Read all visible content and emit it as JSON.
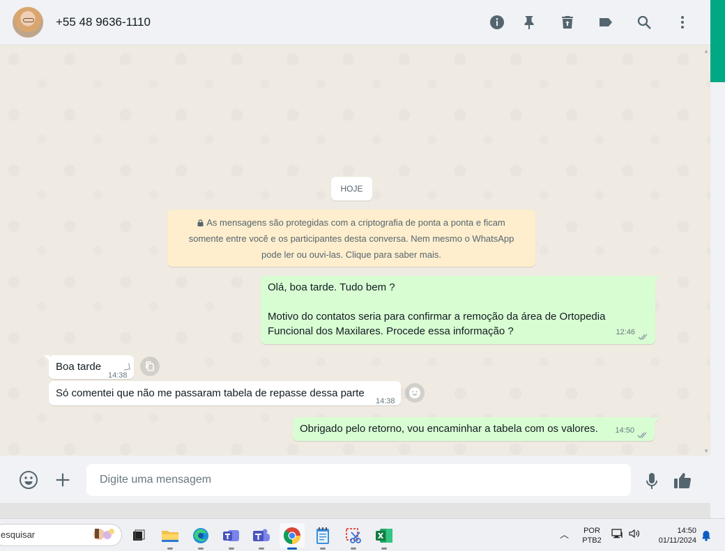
{
  "header": {
    "contact_name": "+55 48 9636-1110",
    "icons": [
      "info-icon",
      "pin-icon",
      "delete-icon",
      "label-icon",
      "search-icon",
      "menu-icon"
    ]
  },
  "chat": {
    "date_chip": "HOJE",
    "encryption_notice": {
      "line1": "As mensagens são protegidas com a criptografia de ponta a ponta e ficam",
      "line2": "somente entre você e os participantes desta conversa. Nem mesmo o WhatsApp",
      "line3": "pode ler ou ouvi-las. Clique para saber mais."
    },
    "messages": [
      {
        "direction": "out",
        "line1": "Olá, boa tarde. Tudo bem ?",
        "line2": "Motivo do contatos seria para confirmar a remoção da área de Ortopedia",
        "line3": "Funcional dos Maxilares. Procede essa informação ?",
        "time": "12:46",
        "status": "read"
      },
      {
        "direction": "in",
        "text": "Boa tarde",
        "time": "14:38"
      },
      {
        "direction": "in",
        "text": "Só comentei que não me passaram tabela de repasse dessa parte",
        "time": "14:38"
      },
      {
        "direction": "out",
        "text": "Obrigado pelo retorno, vou encaminhar a tabela com os valores.",
        "time": "14:50",
        "status": "read"
      }
    ]
  },
  "composer": {
    "placeholder": "Digite uma mensagem",
    "icons": [
      "emoji-icon",
      "plus-icon",
      "mic-icon",
      "thumbs-up-icon"
    ]
  },
  "taskbar": {
    "search_text": "esquisar",
    "apps": [
      "task-view",
      "file-explorer",
      "edge",
      "teams",
      "teams-classic",
      "chrome",
      "notepad",
      "snipping-tool",
      "excel"
    ],
    "active_app": "chrome",
    "language": "POR",
    "keyboard": "PTB2",
    "time": "14:50",
    "date": "01/11/2024"
  },
  "colors": {
    "outgoing_bubble": "#d9fdd3",
    "incoming_bubble": "#ffffff",
    "chat_background": "#efeae2",
    "header_background": "#f0f2f5",
    "encryption_background": "#ffeecd",
    "accent_green": "#00a884"
  }
}
